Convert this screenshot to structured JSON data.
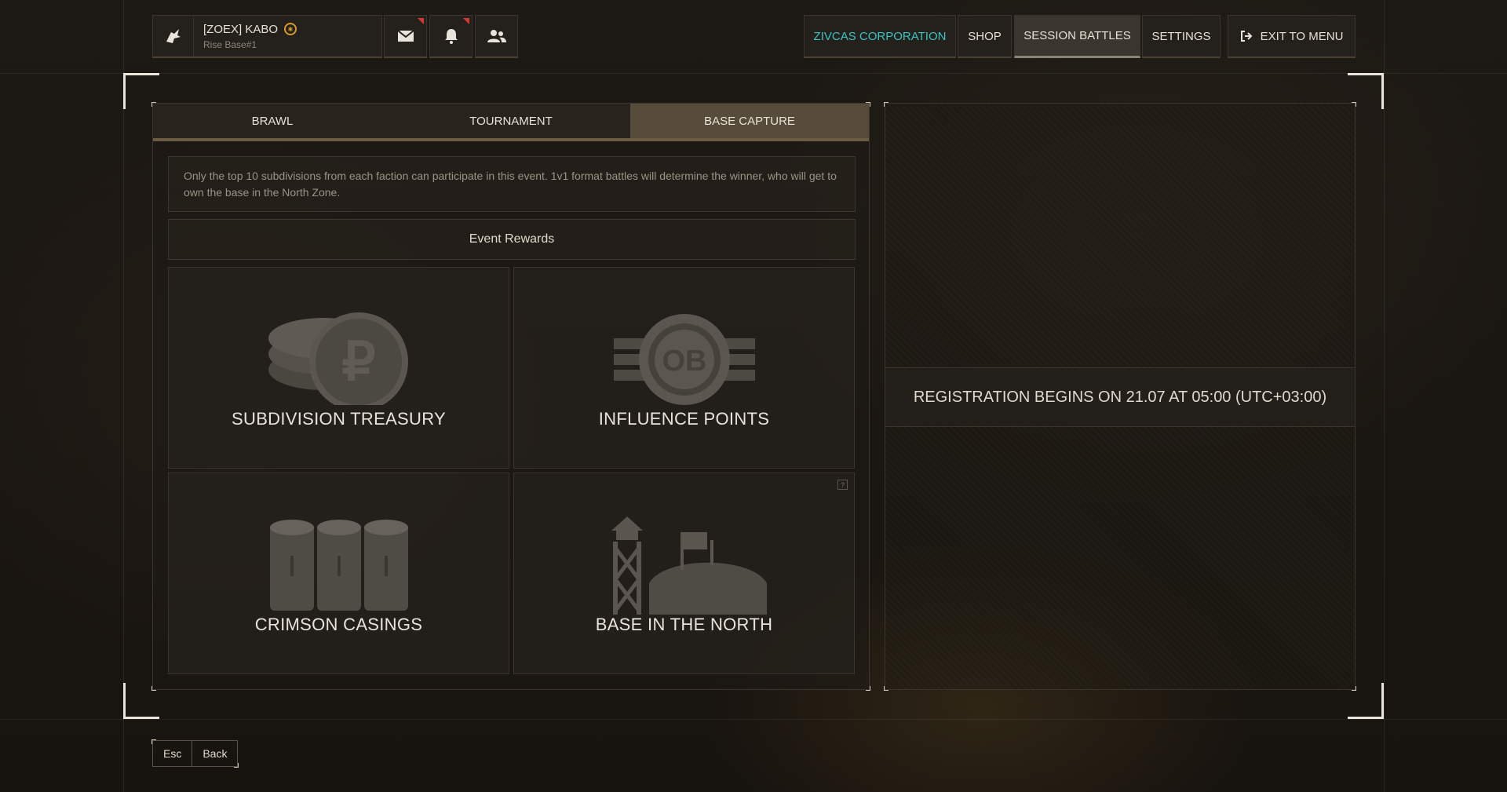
{
  "player": {
    "name": "[ZOEX] KABO",
    "base": "Rise Base#1"
  },
  "icons": {
    "mail": "mail-icon",
    "notifications": "bell-icon",
    "friends": "friends-icon"
  },
  "nav": {
    "corporation": "ZIVCAS CORPORATION",
    "shop": "SHOP",
    "session_battles": "SESSION BATTLES",
    "settings": "SETTINGS",
    "exit": "EXIT TO MENU"
  },
  "tabs": [
    {
      "label": "BRAWL"
    },
    {
      "label": "TOURNAMENT"
    },
    {
      "label": "BASE CAPTURE"
    }
  ],
  "description": "Only the top 10 subdivisions from each faction can participate in this event. 1v1 format battles will determine the winner, who will get to own the base in the North Zone.",
  "rewards": {
    "title": "Event Rewards",
    "items": [
      {
        "label": "SUBDIVISION TREASURY",
        "icon": "treasury-coins-icon"
      },
      {
        "label": "INFLUENCE POINTS",
        "icon": "influence-points-icon"
      },
      {
        "label": "CRIMSON CASINGS",
        "icon": "casings-icon"
      },
      {
        "label": "BASE IN THE NORTH",
        "icon": "base-icon"
      }
    ]
  },
  "registration": "REGISTRATION BEGINS ON 21.07 AT 05:00 (UTC+03:00)",
  "keys": {
    "esc": "Esc",
    "back": "Back"
  },
  "colors": {
    "accent": "#36c4c4",
    "notification": "#d23a3a",
    "tab_active": "#574b39"
  }
}
